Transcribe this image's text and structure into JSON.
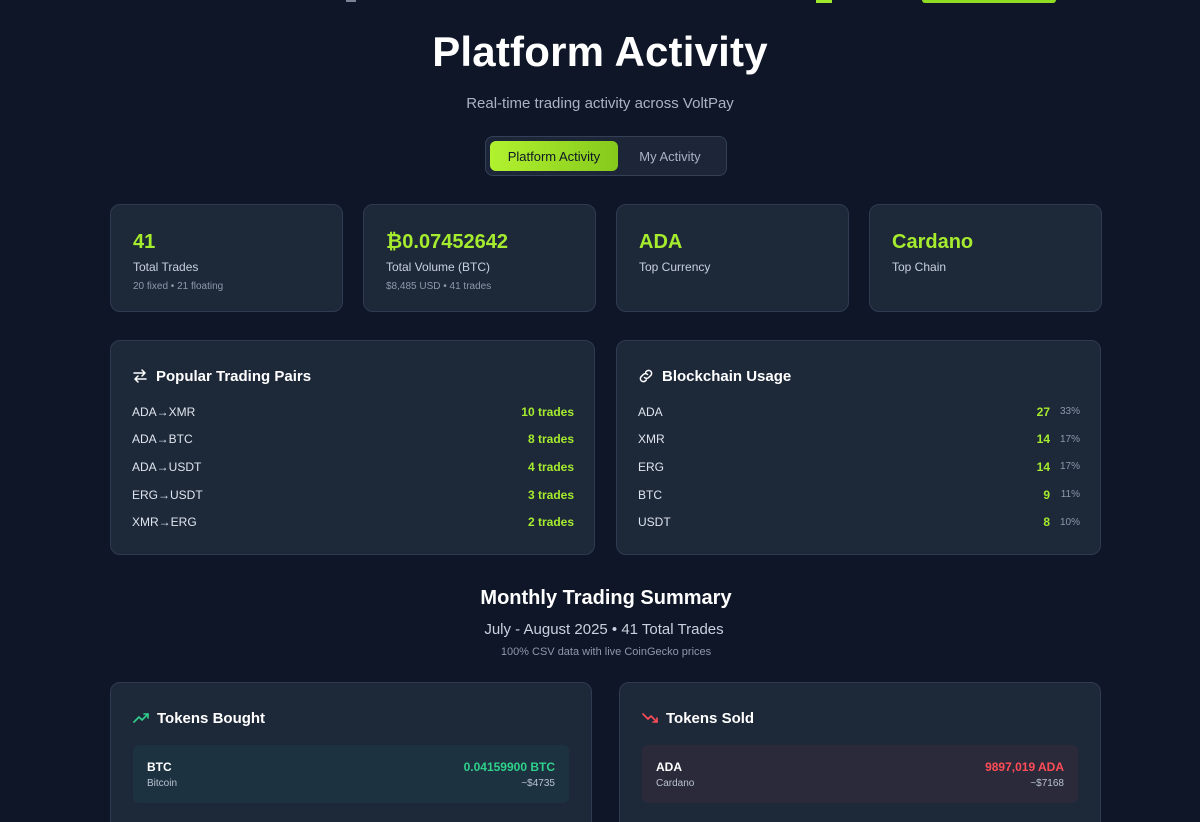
{
  "header": {
    "title": "Platform Activity",
    "subtitle": "Real-time trading activity across VoltPay"
  },
  "toggle": {
    "active": "Platform Activity",
    "inactive": "My Activity"
  },
  "stats": [
    {
      "value": "41",
      "label": "Total Trades",
      "sub": "20 fixed • 21 floating"
    },
    {
      "value": "₿0.07452642",
      "label": "Total Volume (BTC)",
      "sub": "$8,485 USD • 41 trades"
    },
    {
      "value": "ADA",
      "label": "Top Currency",
      "sub": ""
    },
    {
      "value": "Cardano",
      "label": "Top Chain",
      "sub": ""
    }
  ],
  "pairs": {
    "title": "Popular Trading Pairs",
    "icon": "swap-icon",
    "items": [
      {
        "label": "ADA→XMR",
        "value": "10 trades"
      },
      {
        "label": "ADA→BTC",
        "value": "8 trades"
      },
      {
        "label": "ADA→USDT",
        "value": "4 trades"
      },
      {
        "label": "ERG→USDT",
        "value": "3 trades"
      },
      {
        "label": "XMR→ERG",
        "value": "2 trades"
      }
    ]
  },
  "chains": {
    "title": "Blockchain Usage",
    "icon": "link-icon",
    "items": [
      {
        "label": "ADA",
        "value": "27",
        "pct": "33%"
      },
      {
        "label": "XMR",
        "value": "14",
        "pct": "17%"
      },
      {
        "label": "ERG",
        "value": "14",
        "pct": "17%"
      },
      {
        "label": "BTC",
        "value": "9",
        "pct": "11%"
      },
      {
        "label": "USDT",
        "value": "8",
        "pct": "10%"
      }
    ]
  },
  "summary": {
    "title": "Monthly Trading Summary",
    "subtitle": "July - August 2025 • 41 Total Trades",
    "note": "100% CSV data with live CoinGecko prices"
  },
  "bought": {
    "title": "Tokens Bought",
    "icon": "trending-up-icon",
    "items": [
      {
        "symbol": "BTC",
        "name": "Bitcoin",
        "amount": "0.04159900 BTC",
        "usd": "~$4735"
      }
    ]
  },
  "sold": {
    "title": "Tokens Sold",
    "icon": "trending-down-icon",
    "items": [
      {
        "symbol": "ADA",
        "name": "Cardano",
        "amount": "9897,019 ADA",
        "usd": "~$7168"
      }
    ]
  },
  "colors": {
    "background": "#0e1627",
    "card": "#1d2839",
    "accent": "#a6ec2e",
    "buy": "#2fd18b",
    "sell": "#ff4d57"
  }
}
